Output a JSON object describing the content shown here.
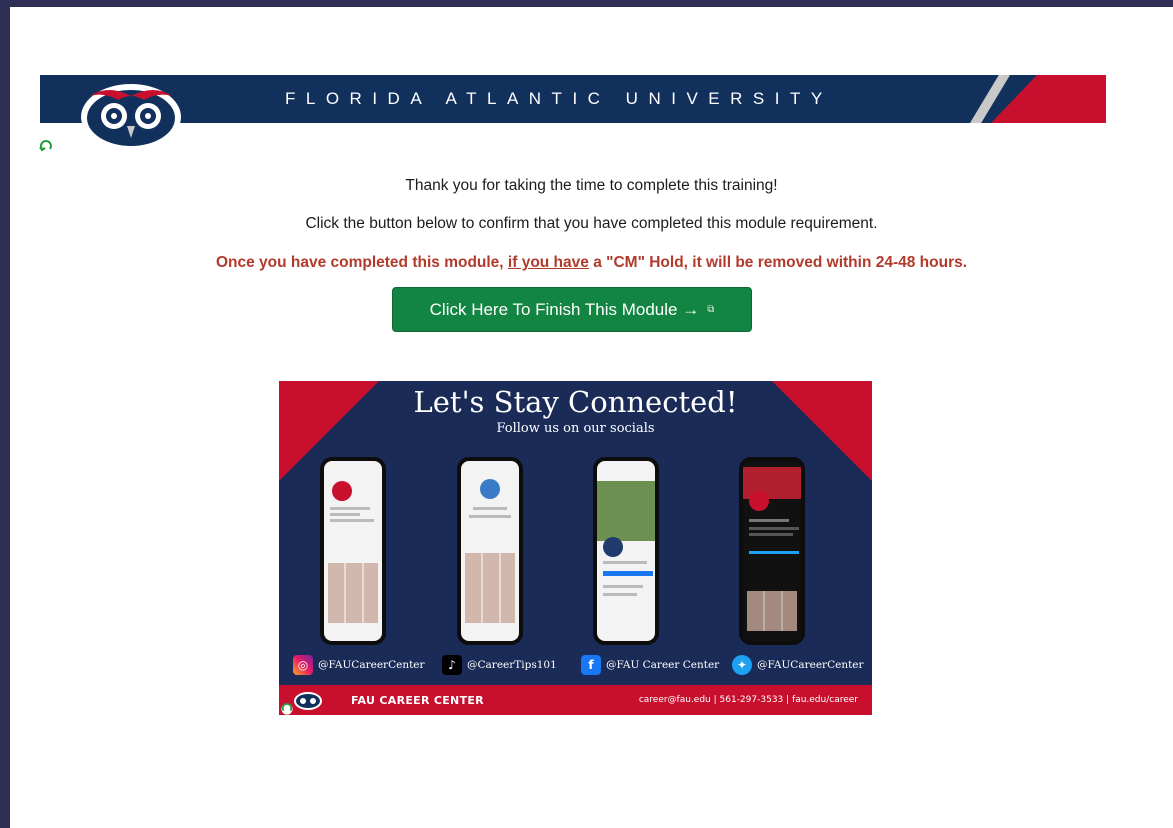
{
  "banner": {
    "title": "FLORIDA ATLANTIC UNIVERSITY"
  },
  "content": {
    "thanks": "Thank you for taking the time to complete this training!",
    "instruction": "Click the button below to confirm that you have completed this module requirement.",
    "notice_prefix": "Once you have completed this module, ",
    "notice_link": "if you have",
    "notice_suffix": " a \"CM\" Hold, it will be removed within 24-48 hours.",
    "button_label": "Click Here To Finish This Module →"
  },
  "social_graphic": {
    "heading": "Let's Stay Connected!",
    "subheading": "Follow us on our socials",
    "handles": [
      {
        "platform": "instagram-icon",
        "text": "@FAUCareerCenter"
      },
      {
        "platform": "tiktok-icon",
        "text": "@CareerTips101"
      },
      {
        "platform": "facebook-icon",
        "text": "@FAU Career Center"
      },
      {
        "platform": "twitter-icon",
        "text": "@FAUCareerCenter"
      }
    ],
    "footer_name": "FAU CAREER CENTER",
    "footer_contact": "career@fau.edu  |  561-297-3533  |  fau.edu/career"
  },
  "colors": {
    "navy": "#12305c",
    "red": "#c8102e",
    "button_green": "#138543",
    "notice_red": "#b23a2b"
  }
}
